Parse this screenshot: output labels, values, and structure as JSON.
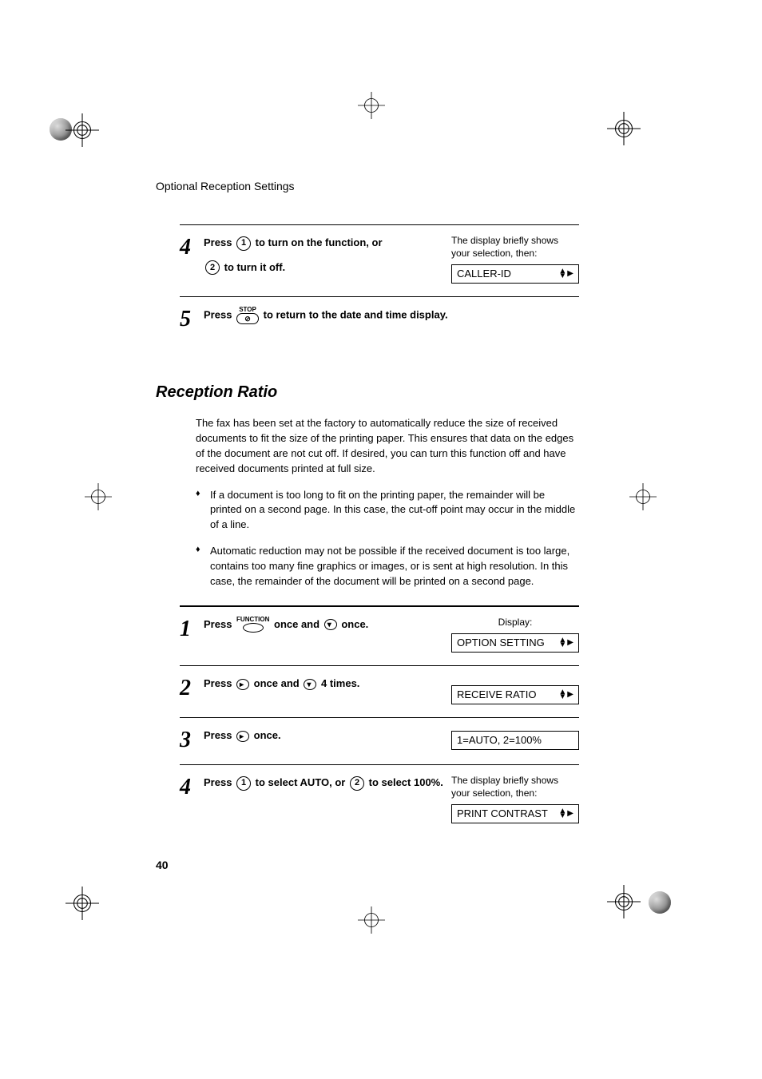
{
  "header": "Optional Reception Settings",
  "pageNumber": "40",
  "topSteps": [
    {
      "num": "4",
      "press": "Press",
      "key1": "1",
      "mid1": "to turn on the function, or",
      "key2": "2",
      "mid2": "to turn it off.",
      "rightNote": "The display briefly shows your selection, then:",
      "display": "CALLER-ID"
    },
    {
      "num": "5",
      "press": "Press",
      "stopLabel": "STOP",
      "rest": "to return to the date and time display."
    }
  ],
  "section2": {
    "title": "Reception Ratio",
    "intro": "The fax has been set at the factory to automatically reduce the size of received documents to fit the size of the printing paper. This ensures that data on the edges of the document are not cut off. If desired, you can turn this function off and have received documents printed at full size.",
    "bullet1": "If a document is too long to fit on the printing paper, the remainder will be printed on a second page. In this case, the cut-off point may occur in the middle of a line.",
    "bullet2": "Automatic reduction may not be possible if the received document is too large, contains too many fine graphics or images, or is sent at high resolution. In this case, the remainder of the document will be printed on a second page.",
    "steps": [
      {
        "num": "1",
        "press": "Press",
        "funcLabel": "FUNCTION",
        "mid1": "once and",
        "mid2": "once.",
        "rightLabel": "Display:",
        "display": "OPTION SETTING"
      },
      {
        "num": "2",
        "press": "Press",
        "mid1": "once and",
        "mid2": "4 times.",
        "display": "RECEIVE RATIO"
      },
      {
        "num": "3",
        "press": "Press",
        "mid1": "once.",
        "display": "1=AUTO, 2=100%"
      },
      {
        "num": "4",
        "press": "Press",
        "key1": "1",
        "mid1": "to select AUTO, or",
        "key2": "2",
        "mid2": "to select 100%.",
        "rightNote": "The display briefly shows your selection, then:",
        "display": "PRINT CONTRAST"
      }
    ]
  }
}
